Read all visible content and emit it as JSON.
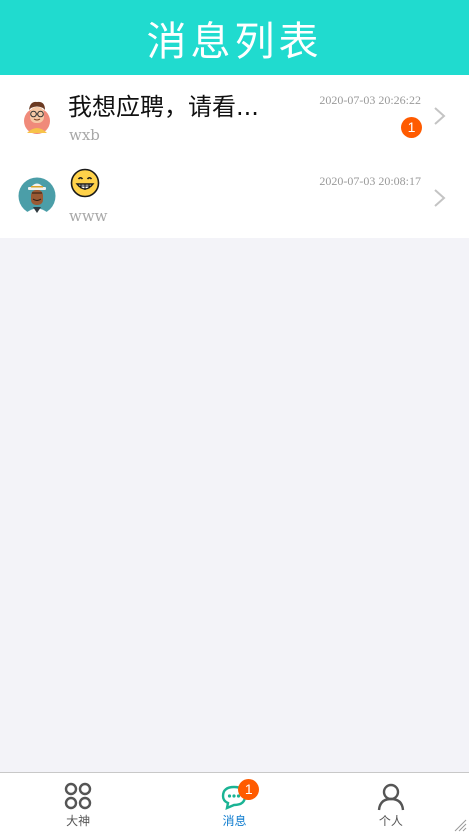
{
  "header": {
    "title": "消息列表"
  },
  "conversations": [
    {
      "preview": "我想应聘，请看...",
      "sender": "wxb",
      "time": "2020-07-03 20:26:22",
      "unread": "1",
      "avatar_icon": "man-glasses-avatar"
    },
    {
      "preview_icon": "grinning-face-emoji",
      "sender": "www",
      "time": "2020-07-03 20:08:17",
      "avatar_icon": "man-hat-avatar"
    }
  ],
  "tabbar": {
    "tabs": [
      {
        "label": "大神",
        "icon": "grid-icon"
      },
      {
        "label": "消息",
        "icon": "chat-bubble-icon",
        "badge": "1",
        "active": true
      },
      {
        "label": "个人",
        "icon": "person-icon"
      }
    ]
  },
  "colors": {
    "header_bg": "#20dbcf",
    "badge": "#ff5b00",
    "active_tab": "#0f7ccf",
    "page_bg": "#f3f3f8"
  }
}
